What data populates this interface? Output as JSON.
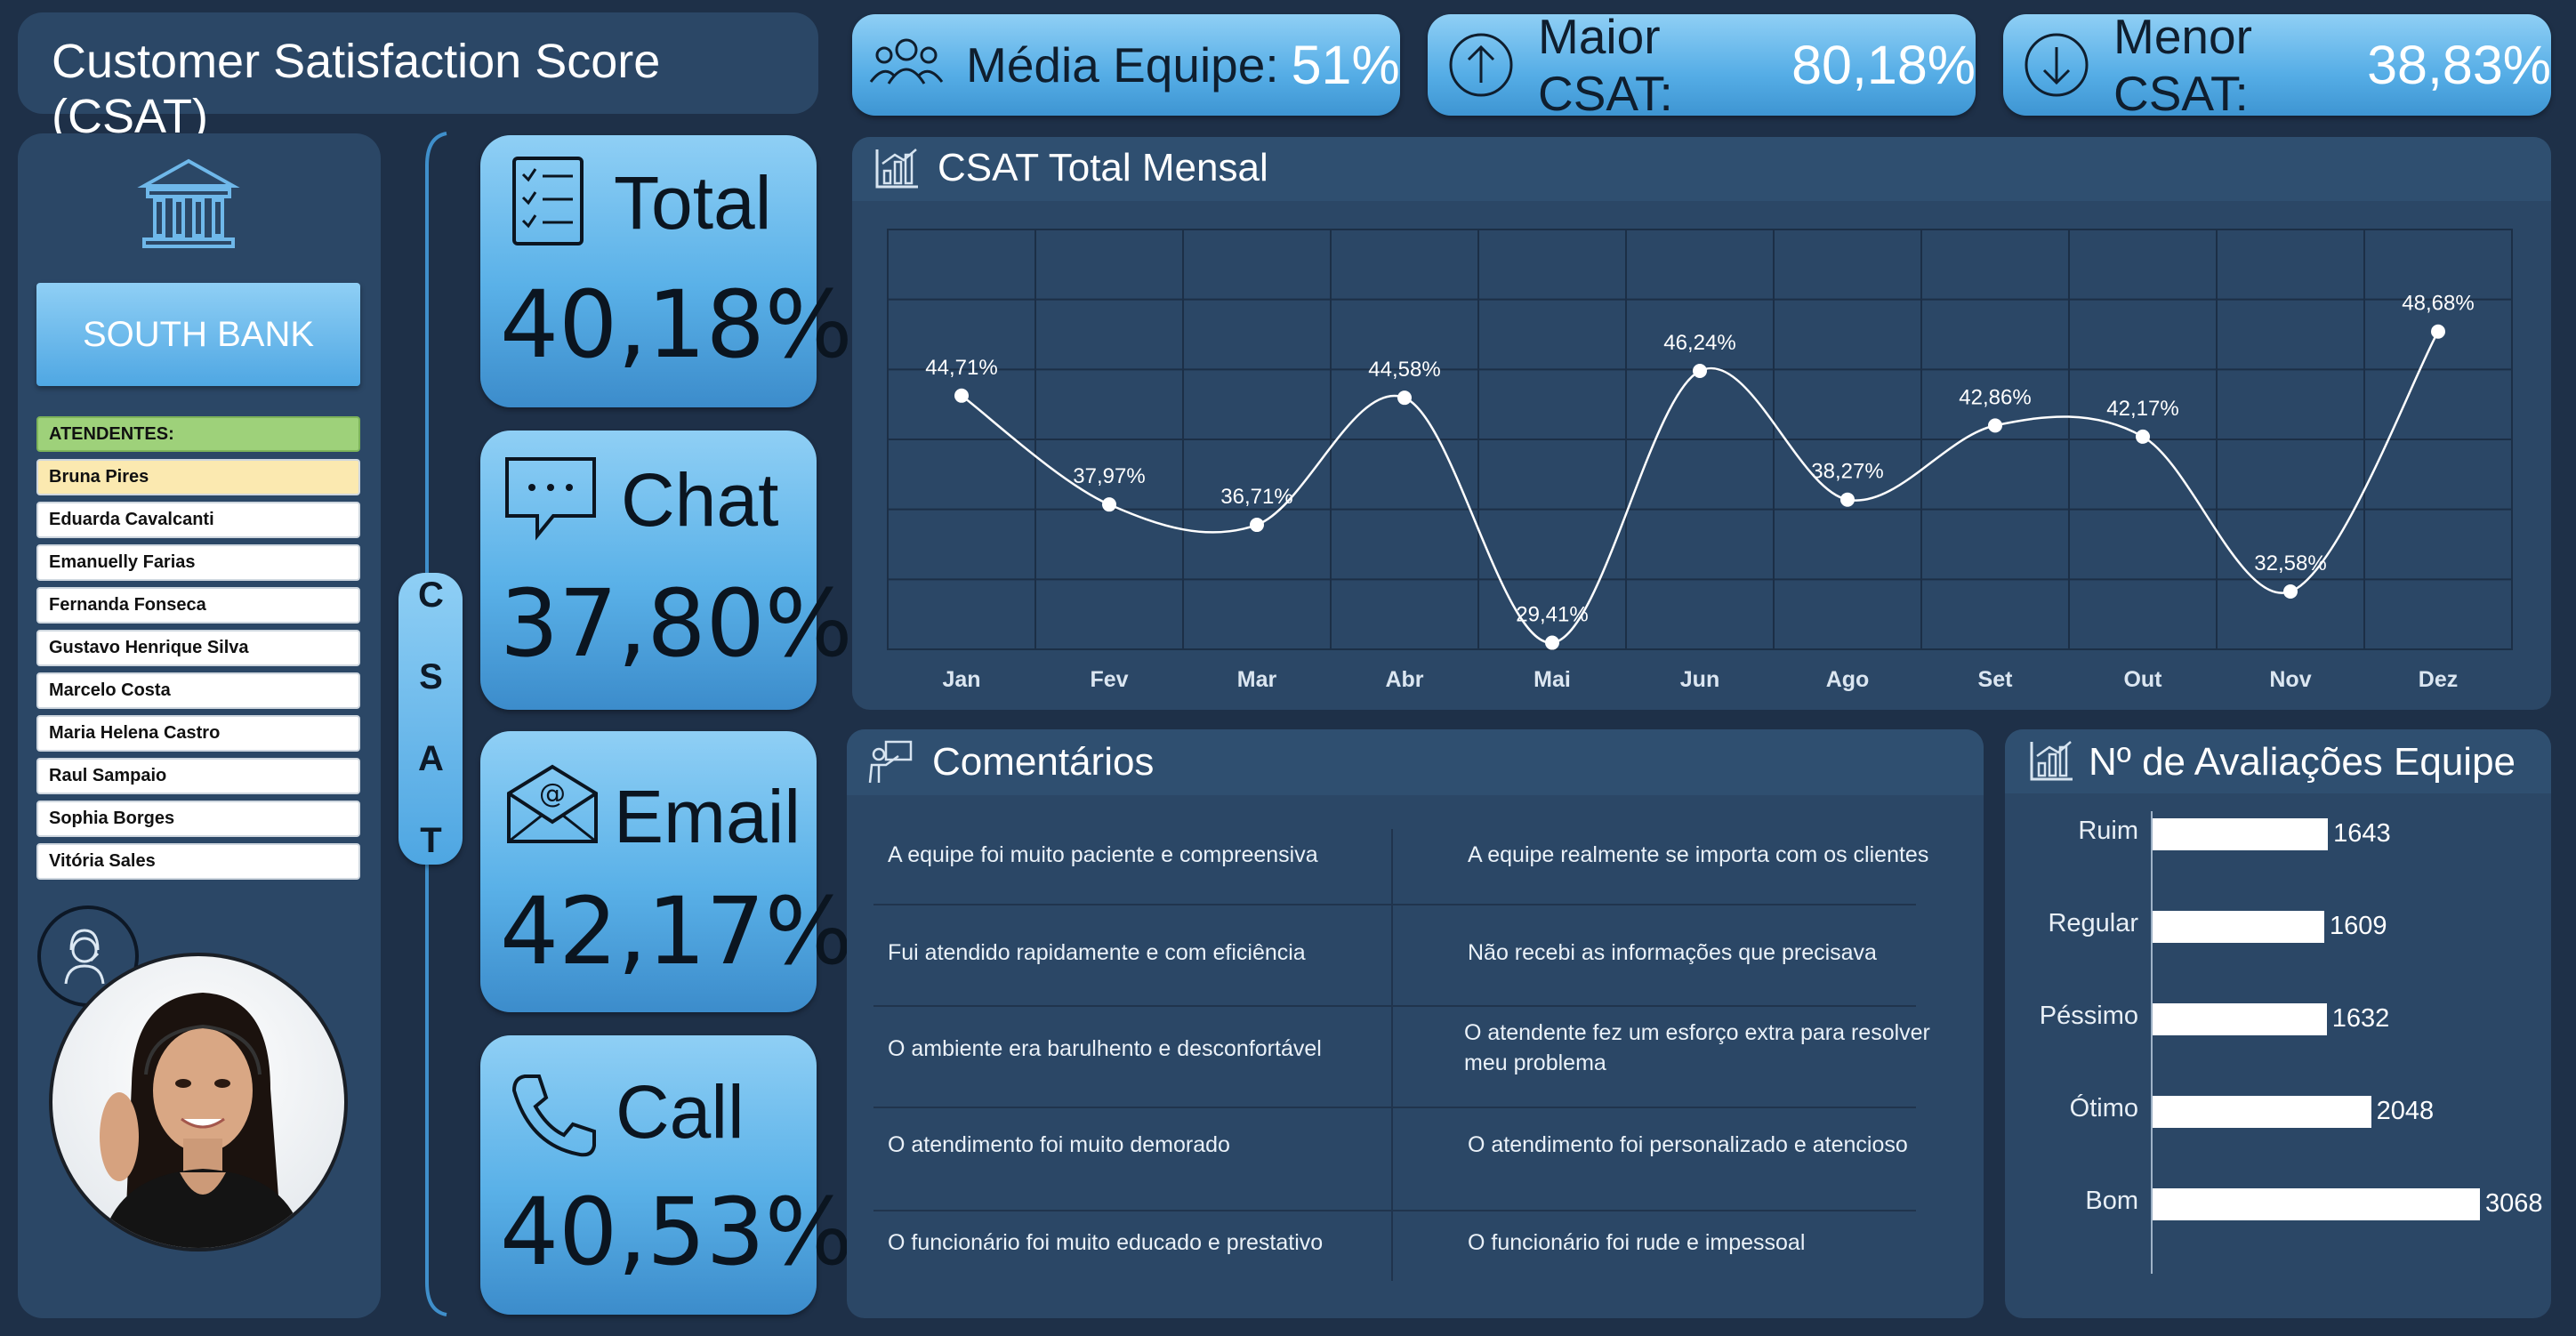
{
  "header": {
    "title": "Customer Satisfaction Score (CSAT)"
  },
  "kpis_top": [
    {
      "label": "Média Equipe:",
      "value": "51%",
      "icon": "team-icon"
    },
    {
      "label": "Maior CSAT:",
      "value": "80,18%",
      "icon": "arrow-up-circle-icon"
    },
    {
      "label": "Menor CSAT:",
      "value": "38,83%",
      "icon": "arrow-down-circle-icon"
    }
  ],
  "sidebar": {
    "bank_name": "SOUTH BANK",
    "agents_header": "ATENDENTES:",
    "agents": [
      "Bruna Pires",
      "Eduarda Cavalcanti",
      "Emanuelly Farias",
      "Fernanda Fonseca",
      "Gustavo Henrique Silva",
      "Marcelo Costa",
      "Maria Helena Castro",
      "Raul Sampaio",
      "Sophia Borges",
      "Vitória Sales"
    ],
    "selected_agent_index": 0
  },
  "csat_vertical_label": "C S A T",
  "channels": [
    {
      "label": "Total",
      "value": "40,18%",
      "icon": "checklist-icon"
    },
    {
      "label": "Chat",
      "value": "37,80%",
      "icon": "chat-bubble-icon"
    },
    {
      "label": "Email",
      "value": "42,17%",
      "icon": "envelope-icon"
    },
    {
      "label": "Call",
      "value": "40,53%",
      "icon": "phone-icon"
    }
  ],
  "line_chart_title": "CSAT Total Mensal",
  "comments_title": "Comentários",
  "comments": [
    [
      "A equipe foi muito paciente e compreensiva",
      "A equipe realmente se importa com os clientes"
    ],
    [
      "Fui atendido rapidamente e com eficiência",
      "Não recebi as informações que precisava"
    ],
    [
      "O ambiente era barulhento e desconfortável",
      "O atendente fez um esforço extra para resolver meu problema"
    ],
    [
      "O atendimento foi muito demorado",
      "O atendimento foi personalizado e atencioso"
    ],
    [
      "O funcionário foi muito educado e prestativo",
      "O funcionário foi rude e impessoal"
    ]
  ],
  "bar_chart_title": "Nº de Avaliações Equipe",
  "colors": {
    "background": "#1e3048",
    "panel": "#2b4766",
    "accent_light": "#8fcff5",
    "accent": "#4aa3de",
    "selected_agent": "#fbe9b0",
    "agents_header": "#9ed17a"
  },
  "chart_data": [
    {
      "type": "line",
      "title": "CSAT Total Mensal",
      "categories": [
        "Jan",
        "Fev",
        "Mar",
        "Abr",
        "Mai",
        "Jun",
        "Ago",
        "Set",
        "Out",
        "Nov",
        "Dez"
      ],
      "values": [
        44.71,
        37.97,
        36.71,
        44.58,
        29.41,
        46.24,
        38.27,
        42.86,
        42.17,
        32.58,
        48.68
      ],
      "data_labels": [
        "44,71%",
        "37,97%",
        "36,71%",
        "44,58%",
        "29,41%",
        "46,24%",
        "38,27%",
        "42,86%",
        "42,17%",
        "32,58%",
        "48,68%"
      ],
      "ylim": [
        29,
        55
      ],
      "grid": true,
      "smooth": true
    },
    {
      "type": "bar",
      "orientation": "horizontal",
      "title": "Nº de Avaliações Equipe",
      "categories": [
        "Ruim",
        "Regular",
        "Péssimo",
        "Ótimo",
        "Bom"
      ],
      "values": [
        1643,
        1609,
        1632,
        2048,
        3068
      ],
      "xlim": [
        0,
        3068
      ]
    }
  ]
}
